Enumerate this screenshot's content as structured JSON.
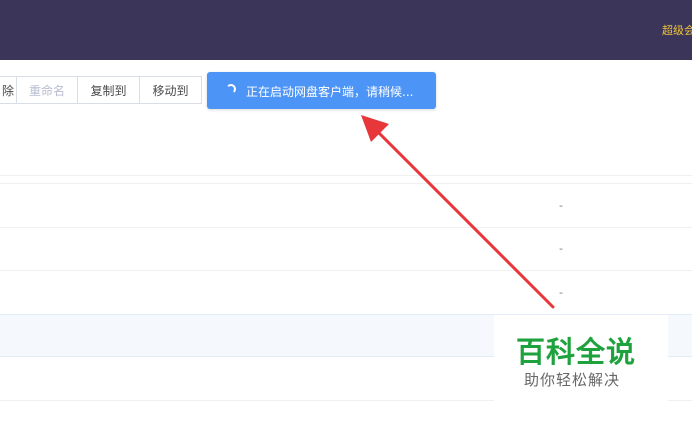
{
  "header": {
    "vip_label": "超级会"
  },
  "toolbar": {
    "delete_partial": "除",
    "rename": "重命名",
    "copy_to": "复制到",
    "move_to": "移动到"
  },
  "toast": {
    "message": "正在启动网盘客户端，请稍候..."
  },
  "file_rows": [
    {
      "size": "-"
    },
    {
      "size": "-"
    },
    {
      "size": "-"
    }
  ],
  "watermark": {
    "title": "百科全说",
    "subtitle": "助你轻松解决"
  },
  "colors": {
    "header_bg": "#3b3559",
    "toast_bg": "#4d94f7",
    "annotation_arrow": "#e8373a",
    "watermark_green": "#1ea23e"
  }
}
